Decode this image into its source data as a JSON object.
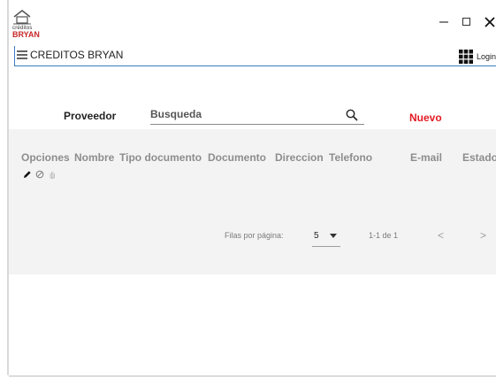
{
  "header": {
    "logo_small": "créditos",
    "logo_brand": "BRYAN",
    "app_title": "CREDITOS BRYAN",
    "login_label": "Login"
  },
  "window_controls": [
    "minimize",
    "maximize",
    "close"
  ],
  "toolbar": {
    "proveedor_label": "Proveedor",
    "search_placeholder": "Busqueda",
    "new_label": "Nuevo"
  },
  "table": {
    "columns": [
      "Opciones",
      "Nombre",
      "Tipo documento",
      "Documento",
      "Direccion",
      "Telefono",
      "E-mail",
      "Estado"
    ],
    "row_actions": [
      "edit-icon",
      "block-icon",
      "hand-icon"
    ]
  },
  "pagination": {
    "rows_per_page_label": "Filas por página:",
    "rows_per_page_value": "5",
    "range_text": "1-1 de 1",
    "prev_glyph": "<",
    "next_glyph": ">"
  },
  "colors": {
    "accent_blue": "#3b7dc4",
    "brand_red": "#c62828",
    "nuevo_red": "#e31b23",
    "panel_bg": "#f3f3f3"
  }
}
